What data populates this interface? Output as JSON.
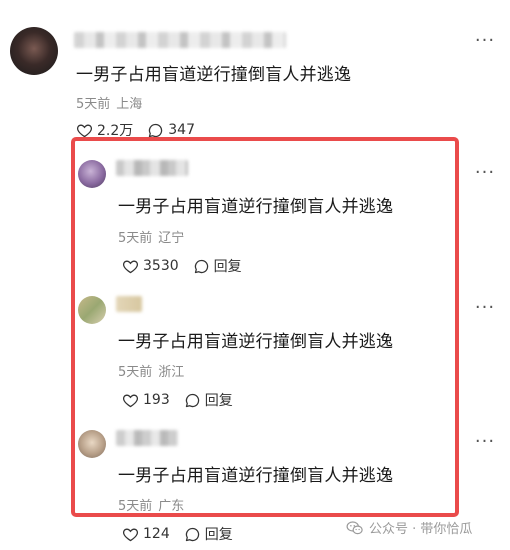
{
  "top_comment": {
    "text": "一男子占用盲道逆行撞倒盲人并逃逸",
    "time": "5天前",
    "location": "上海",
    "likes": "2.2万",
    "replies": "347",
    "more": "···"
  },
  "replies": [
    {
      "text": "一男子占用盲道逆行撞倒盲人并逃逸",
      "time": "5天前",
      "location": "辽宁",
      "likes": "3530",
      "reply_label": "回复",
      "more": "···"
    },
    {
      "text": "一男子占用盲道逆行撞倒盲人并逃逸",
      "time": "5天前",
      "location": "浙江",
      "likes": "193",
      "reply_label": "回复",
      "more": "···"
    },
    {
      "text": "一男子占用盲道逆行撞倒盲人并逃逸",
      "time": "5天前",
      "location": "广东",
      "likes": "124",
      "reply_label": "回复",
      "more": "···"
    }
  ],
  "watermark": {
    "text": "公众号 · 带你恰瓜"
  },
  "colors": {
    "highlight_border": "#ea4b4b",
    "meta_gray": "#8a8a8a"
  }
}
